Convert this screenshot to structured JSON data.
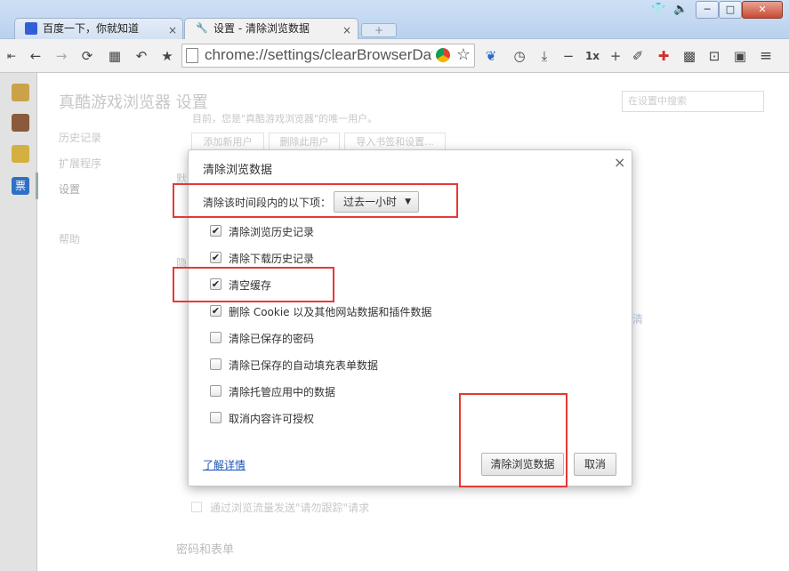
{
  "window": {
    "min_icon": "─",
    "max_icon": "□",
    "close_icon": "✕",
    "shirt_icon": "👕",
    "sound_icon": "🔈"
  },
  "tabs": [
    {
      "title": "百度一下，你就知道",
      "icon": "🐾",
      "close": "×"
    },
    {
      "title": "设置 - 清除浏览数据",
      "icon": "🔧",
      "close": "×"
    }
  ],
  "new_tab": "+",
  "toolbar": {
    "url": "chrome://settings/clearBrowserData",
    "zoom": "1x",
    "icons": {
      "collapse": "⇤",
      "back": "←",
      "forward": "→",
      "reload": "⟳",
      "apps": "▦",
      "undo": "↶",
      "star": "★",
      "bookmark_star": "☆",
      "ext1": "❦",
      "history": "◷",
      "download": "⤓",
      "minus": "−",
      "plus": "+",
      "clean": "✐",
      "stop": "✚",
      "mosaic": "▩",
      "resize": "⊡",
      "window": "▣",
      "menu": "≡"
    }
  },
  "settings_page": {
    "title": "真酷游戏浏览器 设置",
    "search_placeholder": "在设置中搜索",
    "nav": [
      "历史记录",
      "扩展程序",
      "设置",
      "帮助"
    ],
    "users_hint": "目前，您是\"真酷游戏浏览器\"的唯一用户。",
    "user_buttons": [
      "添加新用户",
      "删除此用户",
      "导入书签和设置..."
    ],
    "section_prefix1": "默",
    "section_prefix2": "隐",
    "link_tail": "清",
    "dnt_label": "通过浏览流量发送\"请勿跟踪\"请求",
    "section_pw": "密码和表单"
  },
  "dialog": {
    "title": "清除浏览数据",
    "close": "×",
    "range_label": "清除该时间段内的以下项：",
    "range_value": "过去一小时",
    "items": [
      {
        "label": "清除浏览历史记录",
        "checked": true
      },
      {
        "label": "清除下载历史记录",
        "checked": true
      },
      {
        "label": "清空缓存",
        "checked": true
      },
      {
        "label": "删除 Cookie 以及其他网站数据和插件数据",
        "checked": true
      },
      {
        "label": "清除已保存的密码",
        "checked": false
      },
      {
        "label": "清除已保存的自动填充表单数据",
        "checked": false
      },
      {
        "label": "清除托管应用中的数据",
        "checked": false
      },
      {
        "label": "取消内容许可授权",
        "checked": false
      }
    ],
    "learn_more": "了解详情",
    "clear_button": "清除浏览数据",
    "cancel_button": "取消",
    "checkmark": "✔"
  },
  "colors": {
    "highlight": "#e53935",
    "link": "#1a55b5",
    "sidebar_active": "#2f6fc4"
  }
}
